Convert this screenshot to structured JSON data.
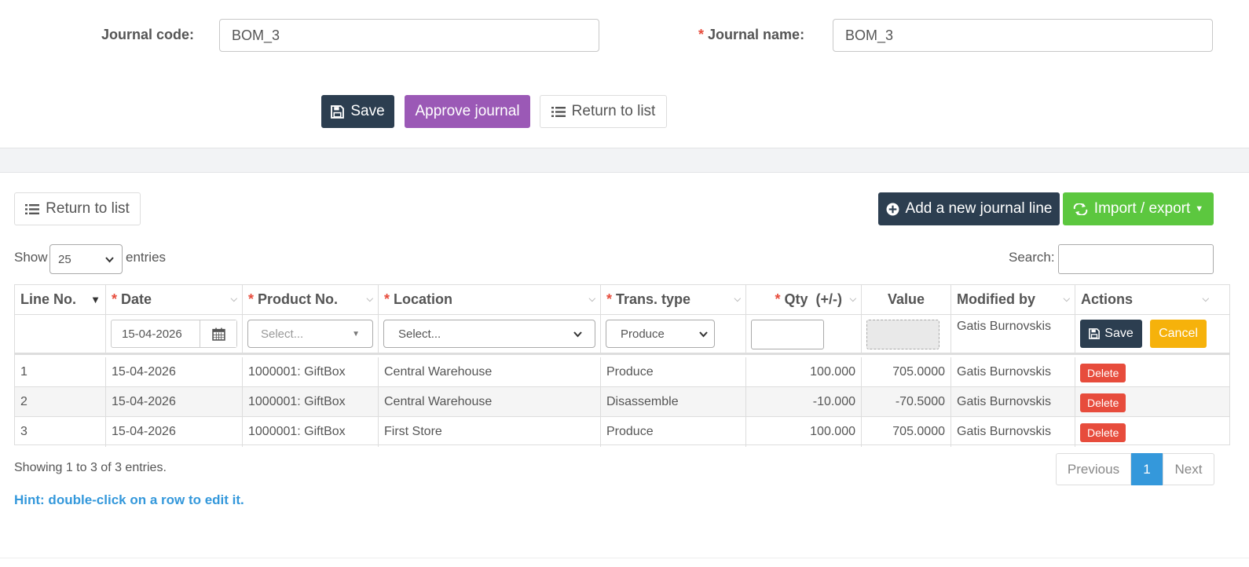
{
  "form": {
    "journal_code_label": "Journal code:",
    "journal_code_value": "BOM_3",
    "journal_name_required": "*",
    "journal_name_label": "Journal name:",
    "journal_name_value": "BOM_3"
  },
  "actions": {
    "save_label": "Save",
    "approve_label": "Approve journal",
    "return_label": "Return to list"
  },
  "lines": {
    "return_label": "Return to list",
    "add_line_label": "Add a new journal line",
    "import_export_label": "Import / export",
    "show_label": "Show",
    "page_size": "25",
    "entries_label": "entries",
    "search_label": "Search:",
    "search_value": ""
  },
  "table": {
    "columns": [
      {
        "label": "Line No.",
        "required": false
      },
      {
        "label": "Date",
        "required": true
      },
      {
        "label": "Product No.",
        "required": true
      },
      {
        "label": "Location",
        "required": true
      },
      {
        "label": "Trans. type",
        "required": true
      },
      {
        "label": "Qty  (+/-)",
        "required": true
      },
      {
        "label": "Value",
        "required": false
      },
      {
        "label": "Modified by",
        "required": false
      },
      {
        "label": "Actions",
        "required": false
      }
    ],
    "required_mark": "*",
    "edit_row": {
      "date": "15-04-2026",
      "product_placeholder": "Select...",
      "location_placeholder": "Select...",
      "trans_type": "Produce",
      "qty": "",
      "modified_by": "Gatis Burnovskis",
      "save_label": "Save",
      "cancel_label": "Cancel"
    },
    "rows": [
      {
        "line": "1",
        "date": "15-04-2026",
        "product": "1000001: GiftBox",
        "location": "Central Warehouse",
        "trans_type": "Produce",
        "qty": "100.000",
        "value": "705.0000",
        "modified_by": "Gatis Burnovskis",
        "action": "Delete"
      },
      {
        "line": "2",
        "date": "15-04-2026",
        "product": "1000001: GiftBox",
        "location": "Central Warehouse",
        "trans_type": "Disassemble",
        "qty": "-10.000",
        "value": "-70.5000",
        "modified_by": "Gatis Burnovskis",
        "action": "Delete"
      },
      {
        "line": "3",
        "date": "15-04-2026",
        "product": "1000001: GiftBox",
        "location": "First Store",
        "trans_type": "Produce",
        "qty": "100.000",
        "value": "705.0000",
        "modified_by": "Gatis Burnovskis",
        "action": "Delete"
      }
    ]
  },
  "footer": {
    "info": "Showing 1 to 3 of 3 entries.",
    "hint": "Hint: double-click on a row to edit it.",
    "previous": "Previous",
    "current_page": "1",
    "next": "Next"
  },
  "colors": {
    "dark": "#2c3e50",
    "purple": "#9b59b6",
    "green": "#5cc73f",
    "danger": "#e74c3c",
    "warning": "#f6b20b",
    "info": "#3498db"
  }
}
